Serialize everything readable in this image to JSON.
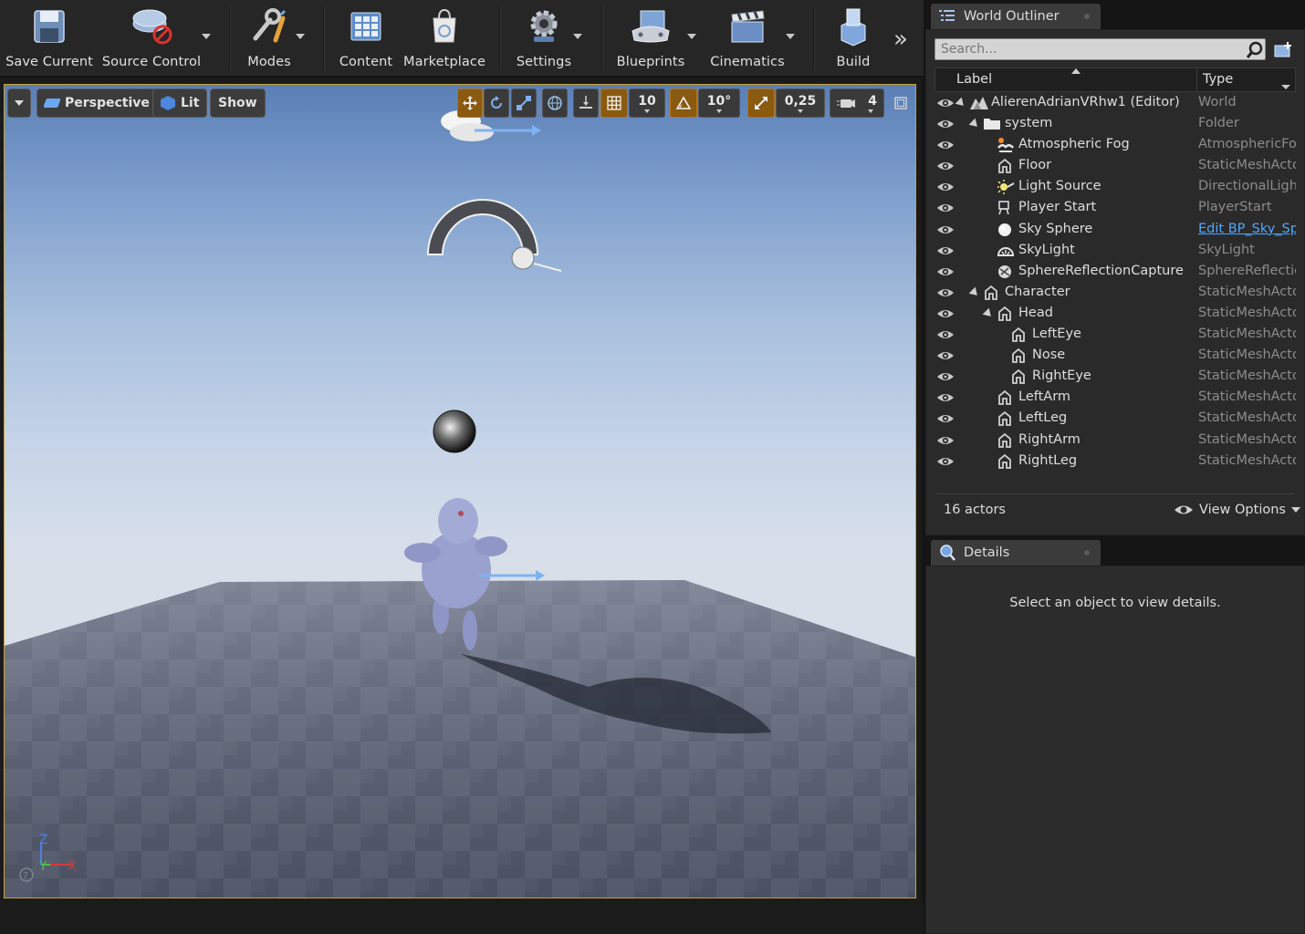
{
  "toolbar": {
    "save": "Save Current",
    "source_control": "Source Control",
    "modes": "Modes",
    "content": "Content",
    "marketplace": "Marketplace",
    "settings": "Settings",
    "blueprints": "Blueprints",
    "cinematics": "Cinematics",
    "build": "Build"
  },
  "viewport": {
    "perspective": "Perspective",
    "lit": "Lit",
    "show": "Show",
    "grid_snap": "10",
    "rotation_snap": "10°",
    "scale_snap": "0,25",
    "camera_speed": "4",
    "axis_z": "Z",
    "axis_y": "Y",
    "axis_x": "X"
  },
  "outliner": {
    "tab": "World Outliner",
    "search_placeholder": "Search...",
    "col_label": "Label",
    "col_type": "Type",
    "rows": [
      {
        "label": "AlierenAdrianVRhw1 (Editor)",
        "type": "World",
        "icon": "world-icon"
      },
      {
        "label": "system",
        "type": "Folder",
        "icon": "folder-icon"
      },
      {
        "label": "Atmospheric Fog",
        "type": "AtmosphericFog",
        "icon": "fog-icon"
      },
      {
        "label": "Floor",
        "type": "StaticMeshActor",
        "icon": "static-mesh-icon"
      },
      {
        "label": "Light Source",
        "type": "DirectionalLight",
        "icon": "directional-light-icon"
      },
      {
        "label": "Player Start",
        "type": "PlayerStart",
        "icon": "player-start-icon"
      },
      {
        "label": "Sky Sphere",
        "type": "Edit BP_Sky_Sphere",
        "icon": "sphere-icon"
      },
      {
        "label": "SkyLight",
        "type": "SkyLight",
        "icon": "skylight-icon"
      },
      {
        "label": "SphereReflectionCapture",
        "type": "SphereReflectionCapture",
        "icon": "reflection-capture-icon"
      },
      {
        "label": "Character",
        "type": "StaticMeshActor",
        "icon": "static-mesh-icon"
      },
      {
        "label": "Head",
        "type": "StaticMeshActor",
        "icon": "static-mesh-icon"
      },
      {
        "label": "LeftEye",
        "type": "StaticMeshActor",
        "icon": "static-mesh-icon"
      },
      {
        "label": "Nose",
        "type": "StaticMeshActor",
        "icon": "static-mesh-icon"
      },
      {
        "label": "RightEye",
        "type": "StaticMeshActor",
        "icon": "static-mesh-icon"
      },
      {
        "label": "LeftArm",
        "type": "StaticMeshActor",
        "icon": "static-mesh-icon"
      },
      {
        "label": "LeftLeg",
        "type": "StaticMeshActor",
        "icon": "static-mesh-icon"
      },
      {
        "label": "RightArm",
        "type": "StaticMeshActor",
        "icon": "static-mesh-icon"
      },
      {
        "label": "RightLeg",
        "type": "StaticMeshActor",
        "icon": "static-mesh-icon"
      }
    ],
    "actor_count": "16 actors",
    "view_options": "View Options"
  },
  "details": {
    "tab": "Details",
    "message": "Select an object to view details."
  },
  "colors": {
    "accent_orange": "#c8a238",
    "link_blue": "#4fa7ff",
    "panel_bg": "#2a2a2a"
  }
}
